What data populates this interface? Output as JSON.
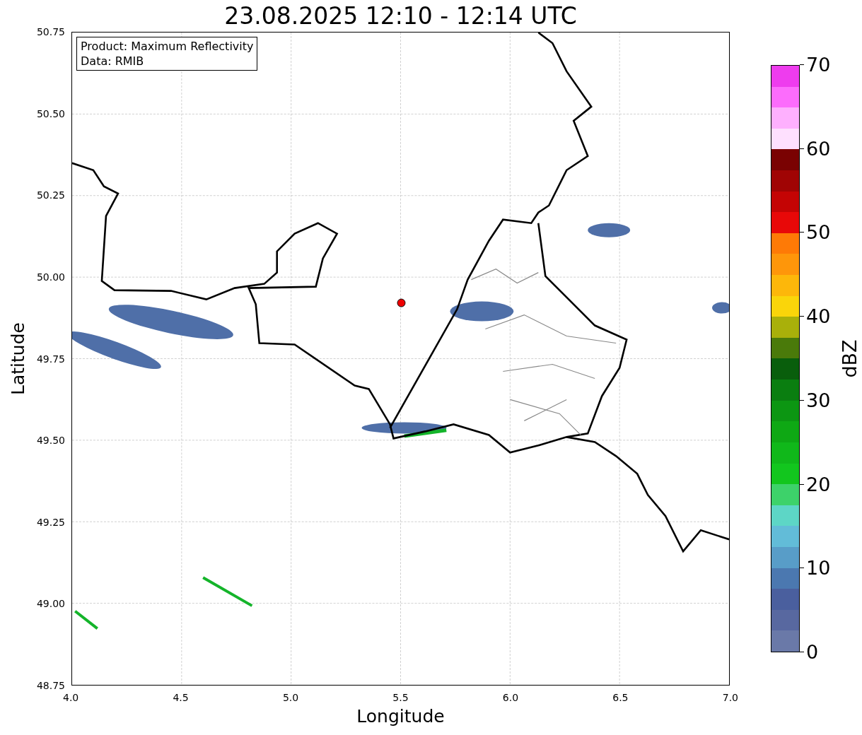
{
  "title": "23.08.2025 12:10 - 12:14 UTC",
  "legend": {
    "lines": [
      "Product: Maximum Reflectivity",
      "Data: RMIB"
    ]
  },
  "x_axis": {
    "label": "Longitude",
    "ticks": [
      "4.0",
      "4.5",
      "5.0",
      "5.5",
      "6.0",
      "6.5",
      "7.0"
    ]
  },
  "y_axis": {
    "label": "Latitude",
    "ticks": [
      "50.75",
      "50.50",
      "50.25",
      "50.00",
      "49.75",
      "49.50",
      "49.25",
      "49.00",
      "48.75"
    ]
  },
  "colorbar": {
    "label": "dBZ",
    "ticks": [
      "70",
      "60",
      "50",
      "40",
      "30",
      "20",
      "10",
      "0"
    ],
    "bands": [
      {
        "color": "#6a79a8"
      },
      {
        "color": "#5868a0"
      },
      {
        "color": "#4a5f9e"
      },
      {
        "color": "#4b78b0"
      },
      {
        "color": "#589dc8"
      },
      {
        "color": "#62bcd8"
      },
      {
        "color": "#5dd6c6"
      },
      {
        "color": "#3dd26a"
      },
      {
        "color": "#12c61e"
      },
      {
        "color": "#10b81a"
      },
      {
        "color": "#0ea814"
      },
      {
        "color": "#0c9612"
      },
      {
        "color": "#0a7e10"
      },
      {
        "color": "#095e0c"
      },
      {
        "color": "#4a7a0a"
      },
      {
        "color": "#a9b00a"
      },
      {
        "color": "#fad50a"
      },
      {
        "color": "#fdb70a"
      },
      {
        "color": "#fe960a"
      },
      {
        "color": "#fe7a06"
      },
      {
        "color": "#e80808"
      },
      {
        "color": "#c40404"
      },
      {
        "color": "#a00404"
      },
      {
        "color": "#7a0202"
      },
      {
        "color": "#fee0fe"
      },
      {
        "color": "#feb0fe"
      },
      {
        "color": "#fc6cfc"
      },
      {
        "color": "#ee3cee"
      }
    ]
  }
}
